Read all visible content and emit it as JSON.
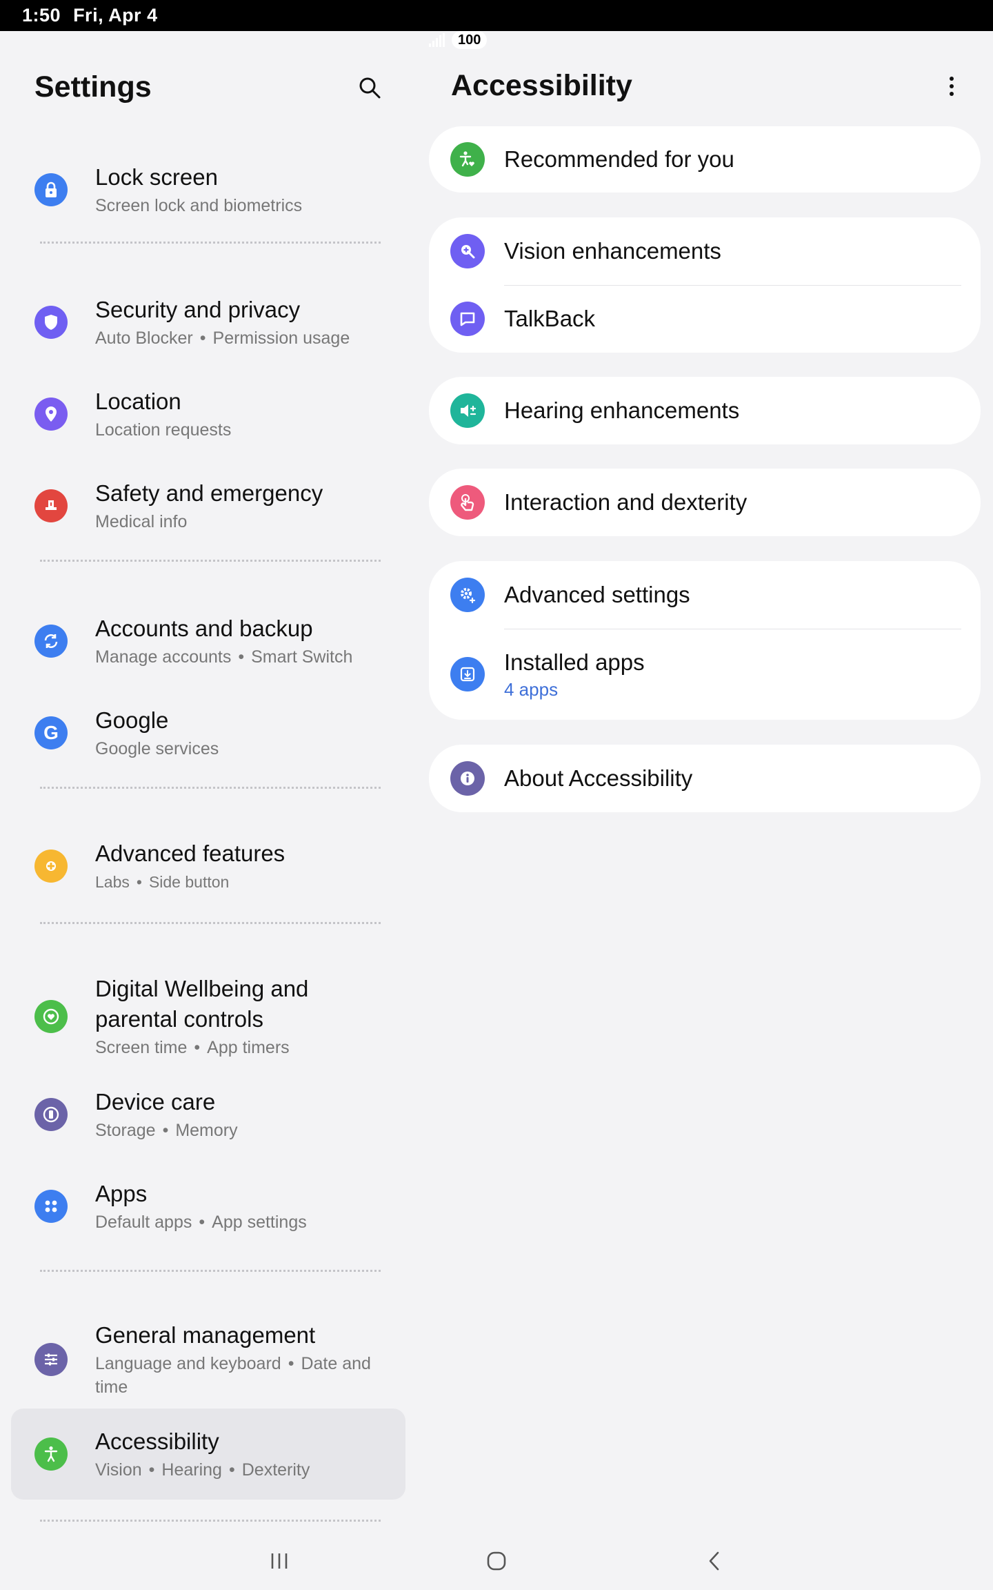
{
  "status_bar": {
    "time": "1:50",
    "date": "Fri, Apr 4",
    "battery": "100"
  },
  "left_pane": {
    "title": "Settings",
    "items": [
      {
        "title": "Lock screen",
        "subs": [
          "Screen lock and biometrics"
        ],
        "icon": "lock-icon",
        "color": "#3d7ef0"
      },
      {
        "title": "Security and privacy",
        "subs": [
          "Auto Blocker",
          "Permission usage"
        ],
        "icon": "shield-icon",
        "color": "#6f5ff2"
      },
      {
        "title": "Location",
        "subs": [
          "Location requests"
        ],
        "icon": "location-pin-icon",
        "color": "#7a5df0"
      },
      {
        "title": "Safety and emergency",
        "subs": [
          "Medical info"
        ],
        "icon": "emergency-icon",
        "color": "#e2463f"
      },
      {
        "title": "Accounts and backup",
        "subs": [
          "Manage accounts",
          "Smart Switch"
        ],
        "icon": "sync-icon",
        "color": "#3d7ef0"
      },
      {
        "title": "Google",
        "subs": [
          "Google services"
        ],
        "icon": "google-icon",
        "color": "#3d7ef0"
      },
      {
        "title": "Advanced features",
        "subs": [
          "Labs",
          "Side button"
        ],
        "icon": "puzzle-gear-icon",
        "color": "#f7b731"
      },
      {
        "title_line1": "Digital Wellbeing and",
        "title_line2": "parental controls",
        "subs": [
          "Screen time",
          "App timers"
        ],
        "icon": "wellbeing-heart-icon",
        "color": "#4cbe4a"
      },
      {
        "title": "Device care",
        "subs": [
          "Storage",
          "Memory"
        ],
        "icon": "device-care-icon",
        "color": "#6b63a8"
      },
      {
        "title": "Apps",
        "subs": [
          "Default apps",
          "App settings"
        ],
        "icon": "apps-grid-icon",
        "color": "#3d7ef0"
      },
      {
        "title": "General management",
        "sub_line1_a": "Language and keyboard",
        "sub_line1_b": "Date and",
        "sub_line2": "time",
        "icon": "sliders-icon",
        "color": "#6b63a8"
      },
      {
        "title": "Accessibility",
        "subs": [
          "Vision",
          "Hearing",
          "Dexterity"
        ],
        "icon": "accessibility-person-icon",
        "color": "#4cbe4a"
      }
    ]
  },
  "right_pane": {
    "title": "Accessibility",
    "items": {
      "recommended": {
        "label": "Recommended for you",
        "color": "#3fb14a"
      },
      "vision": {
        "label": "Vision enhancements",
        "color": "#6f5ff2"
      },
      "talkback": {
        "label": "TalkBack",
        "color": "#6f5ff2"
      },
      "hearing": {
        "label": "Hearing enhancements",
        "color": "#1fb59a"
      },
      "interaction": {
        "label": "Interaction and dexterity",
        "color": "#ee5a7c"
      },
      "advanced": {
        "label": "Advanced settings",
        "color": "#3d7ef0"
      },
      "installed": {
        "label": "Installed apps",
        "sub": "4 apps",
        "color": "#3d7ef0"
      },
      "about": {
        "label": "About Accessibility",
        "color": "#6b63a8"
      }
    }
  },
  "colors": {
    "background": "#f3f3f5",
    "card": "#ffffff",
    "link_blue": "#3e6fd8",
    "selected_bg": "#e6e6ea"
  }
}
